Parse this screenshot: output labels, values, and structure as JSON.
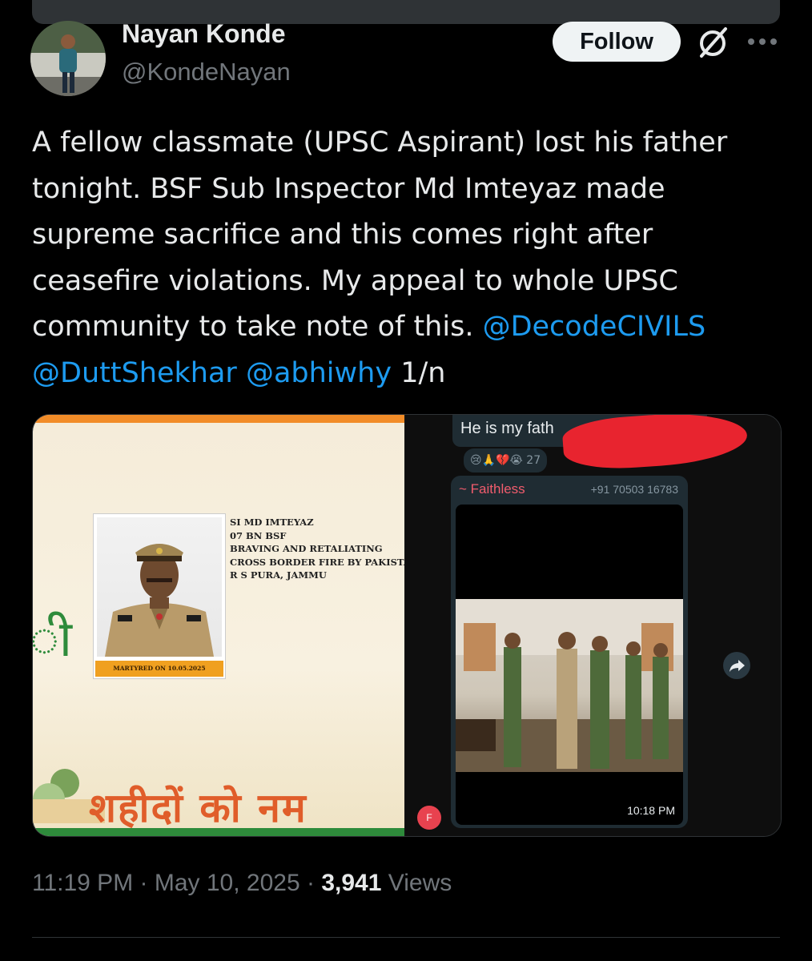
{
  "author": {
    "name": "Nayan Konde",
    "handle": "@KondeNayan"
  },
  "actions": {
    "follow_label": "Follow",
    "grok_icon": "grok-icon",
    "more_icon": "more-options-icon"
  },
  "tweet": {
    "text": "A fellow classmate (UPSC Aspirant) lost his father tonight. BSF Sub Inspector Md Imteyaz made supreme sacrifice and this comes right after ceasefire violations. My appeal to whole UPSC community to take note of this. ",
    "mentions": [
      "@DecodeCIVILS",
      "@DuttShekhar",
      "@abhiwhy"
    ],
    "suffix": "1/n"
  },
  "media": {
    "poster": {
      "details": [
        "SI MD IMTEYAZ",
        "07 BN BSF",
        "BRAVING AND RETALIATING",
        "CROSS BORDER FIRE BY PAKISTA",
        "R S PURA, JAMMU"
      ],
      "martyred": "MARTYRED ON 10.05.2025",
      "hindi_banner": "शहीदों को नम",
      "hindi_left": "ी"
    },
    "chat": {
      "message_top": "He is my fath",
      "reactions": "😢🙏💔😭",
      "reaction_count": "27",
      "sender": "~ Faithless",
      "phone": "+91 70503 16783",
      "time": "10:18 PM",
      "avatar_letter": "F",
      "forward_icon": "forward-icon"
    }
  },
  "meta": {
    "time": "11:19 PM",
    "date": "May 10, 2025",
    "views_count": "3,941",
    "views_label": "Views"
  },
  "colors": {
    "link": "#1d9bf0",
    "background": "#000000",
    "secondary": "#71767b"
  }
}
